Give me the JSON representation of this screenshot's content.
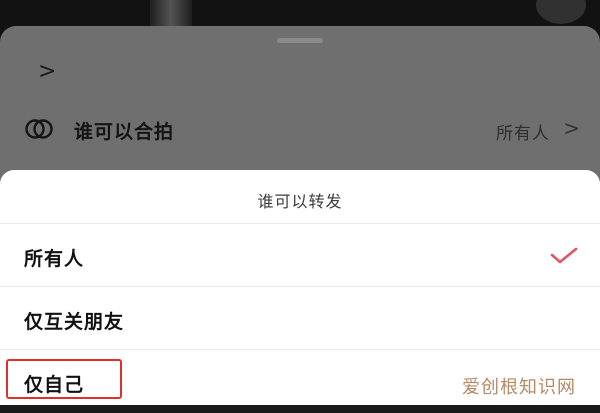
{
  "back_sheet": {
    "chevron": ">",
    "row": {
      "icon": "duet-icon",
      "label": "谁可以合拍",
      "value": "所有人",
      "chevron": ">"
    }
  },
  "action_sheet": {
    "title": "谁可以转发",
    "options": [
      {
        "label": "所有人",
        "selected": true,
        "check_icon": "check-icon"
      },
      {
        "label": "仅互关朋友",
        "selected": false
      },
      {
        "label": "仅自己",
        "selected": false,
        "highlighted": true
      }
    ]
  },
  "watermark": "爱创根知识网",
  "colors": {
    "check": "#e0556a",
    "highlight_border": "#e0302c",
    "watermark": "#b58a66"
  }
}
